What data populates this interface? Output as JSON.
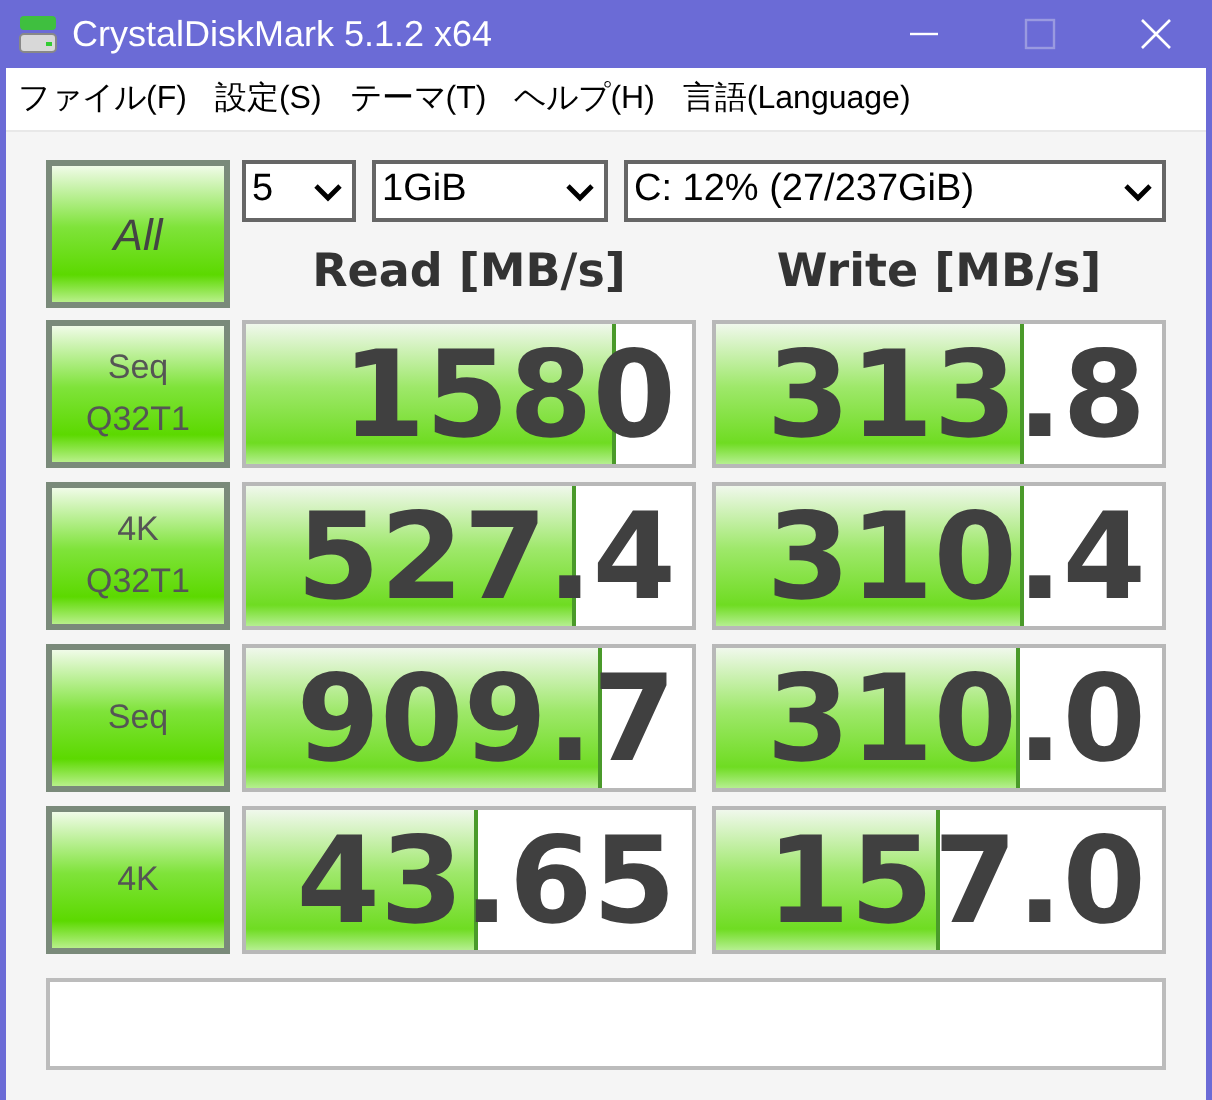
{
  "window": {
    "title": "CrystalDiskMark 5.1.2 x64"
  },
  "menu": [
    "ファイル(F)",
    "設定(S)",
    "テーマ(T)",
    "ヘルプ(H)",
    "言語(Language)"
  ],
  "all_button": "All",
  "selectors": [
    {
      "value": "5"
    },
    {
      "value": "1GiB"
    },
    {
      "value": "C: 12% (27/237GiB)"
    }
  ],
  "headers": [
    "Read [MB/s]",
    "Write [MB/s]"
  ],
  "rows": [
    {
      "label": [
        "Seq",
        "Q32T1"
      ],
      "read": {
        "value": "1580",
        "level": 0.83
      },
      "write": {
        "value": "313.8",
        "level": 0.69
      }
    },
    {
      "label": [
        "4K",
        "Q32T1"
      ],
      "read": {
        "value": "527.4",
        "level": 0.74
      },
      "write": {
        "value": "310.4",
        "level": 0.69
      }
    },
    {
      "label": [
        "Seq"
      ],
      "read": {
        "value": "909.7",
        "level": 0.8
      },
      "write": {
        "value": "310.0",
        "level": 0.68
      }
    },
    {
      "label": [
        "4K"
      ],
      "read": {
        "value": "43.65",
        "level": 0.52
      },
      "write": {
        "value": "157.0",
        "level": 0.5
      }
    }
  ]
}
